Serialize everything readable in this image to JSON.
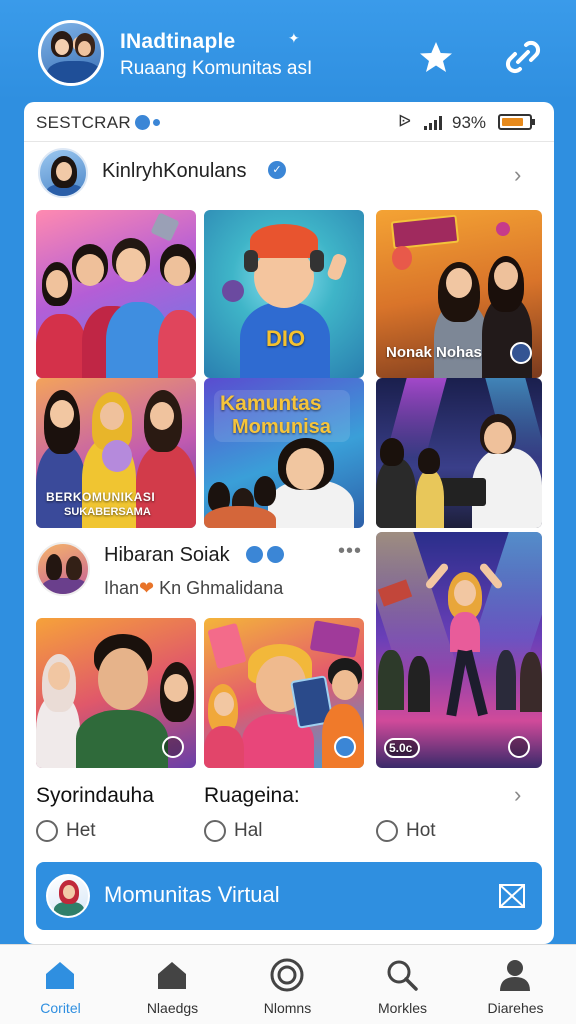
{
  "header": {
    "title": "INadtinaple",
    "subtitle": "Ruaang Komunitas asI"
  },
  "status_bar": {
    "label": "SESTCRAR",
    "battery_text": "93%",
    "battery_level": 0.8
  },
  "profile": {
    "name": "KinlryhKonulans"
  },
  "tiles": {
    "tile3_caption": "Nonak Nohas",
    "tile5_title_line1": "Kamuntas",
    "tile5_title_line2": "Momunisa",
    "tile4_caption": "BERKOMUNIKASI",
    "tile4_caption2": "SUKABERSAMA",
    "tile1_badge": "DIO",
    "tile9_badge": "5.0c"
  },
  "post": {
    "title": "Hibaran Soiak",
    "subtitle_pre": "Ihan",
    "subtitle_post": "Kn Ghmalidana",
    "more": "•••"
  },
  "captions": {
    "left": "Syorindauha",
    "mid": "Ruageina:"
  },
  "likes": {
    "left": "Het",
    "mid": "Hal",
    "right": "Hot"
  },
  "banner": {
    "label": "Momunitas Virtual"
  },
  "nav": [
    {
      "label": "Coritel",
      "icon": "home-icon",
      "active": true
    },
    {
      "label": "Nlaedgs",
      "icon": "house-icon",
      "active": false
    },
    {
      "label": "Nlomns",
      "icon": "circle-icon",
      "active": false
    },
    {
      "label": "Morkles",
      "icon": "search-icon",
      "active": false
    },
    {
      "label": "Diarehes",
      "icon": "person-icon",
      "active": false
    }
  ],
  "colors": {
    "brand_blue": "#2f8fe0",
    "accent_orange": "#e8742a"
  }
}
